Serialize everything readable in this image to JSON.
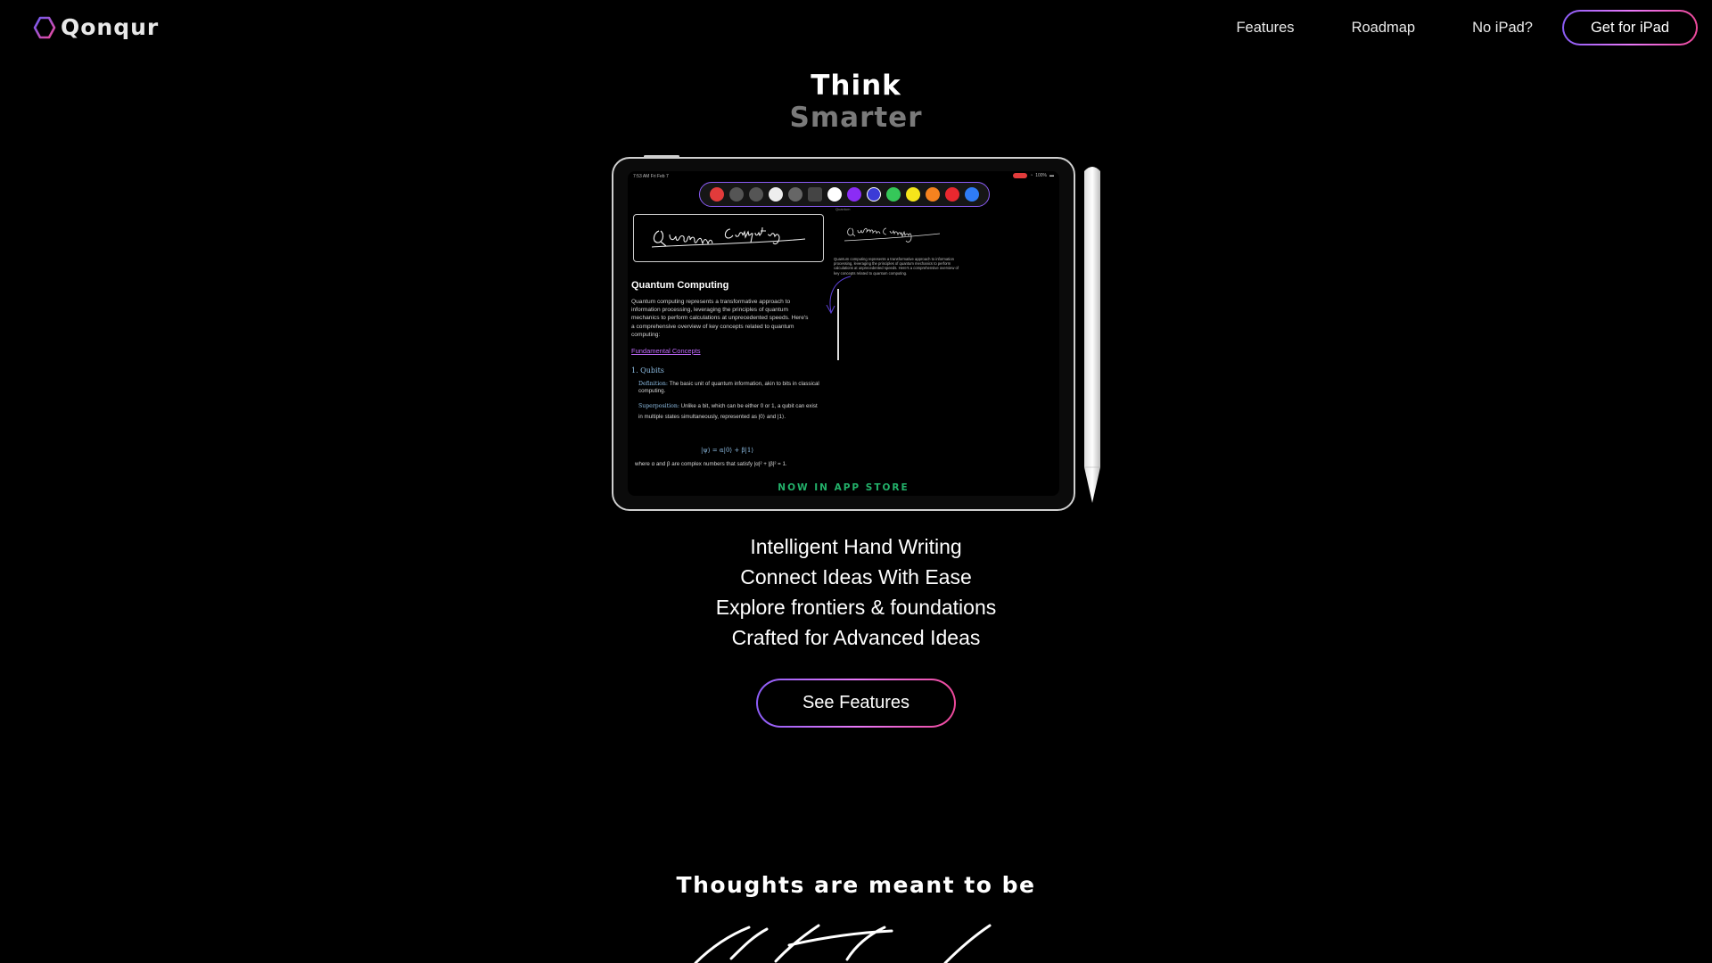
{
  "brand": {
    "name": "Qonqur"
  },
  "nav": {
    "links": [
      "Features",
      "Roadmap",
      "No iPad?"
    ],
    "cta_label": "Get for iPad"
  },
  "hero": {
    "line1": "Think",
    "line2": "Smarter"
  },
  "tablet": {
    "status_time": "7:53 AM   Fri Feb 7",
    "status_battery": "100%",
    "toolbar_colors": [
      "#ffffff",
      "#8b2cf5",
      "#3b3bd6",
      "#35c759",
      "#f5e51b",
      "#f5821f",
      "#e8282f",
      "#2f7cf6"
    ],
    "canvas_label": "Quantum",
    "handwritten_title": "Quantum Computing",
    "doc_heading": "Quantum Computing",
    "doc_intro": "Quantum computing represents a transformative approach to information processing, leveraging the principles of quantum mechanics to perform calculations at unprecedented speeds. Here's a comprehensive overview of key concepts related to quantum computing:",
    "doc_link": "Fundamental Concepts",
    "doc_section": "1. Qubits",
    "def_label": "Definition:",
    "def_text": " The basic unit of quantum information, akin to bits in classical computing.",
    "sup_label": "Superposition:",
    "sup_text": " Unlike a bit, which can be either 0 or 1, a qubit can exist in multiple states simultaneously, represented as |0⟩ and |1⟩.",
    "equation": "|ψ⟩ = α|0⟩ + β|1⟩",
    "where_text": "where α and β are complex numbers that satisfy |α|² + |β|² = 1.",
    "side_text": "Quantum computing represents a transformative approach to information processing, leveraging the principles of quantum mechanics to perform calculations at unprecedented speeds. Here's a comprehensive overview of key concepts related to quantum computing.",
    "banner": "NOW IN APP STORE"
  },
  "taglines": [
    "Intelligent Hand Writing",
    "Connect Ideas With Ease",
    "Explore frontiers & foundations",
    "Crafted for Advanced Ideas"
  ],
  "see_features_label": "See Features",
  "thoughts_heading": "Thoughts are meant to be",
  "colors": {
    "accent_purple": "#8a5cf6",
    "accent_pink": "#ec4899",
    "banner_green": "#23b16a"
  }
}
